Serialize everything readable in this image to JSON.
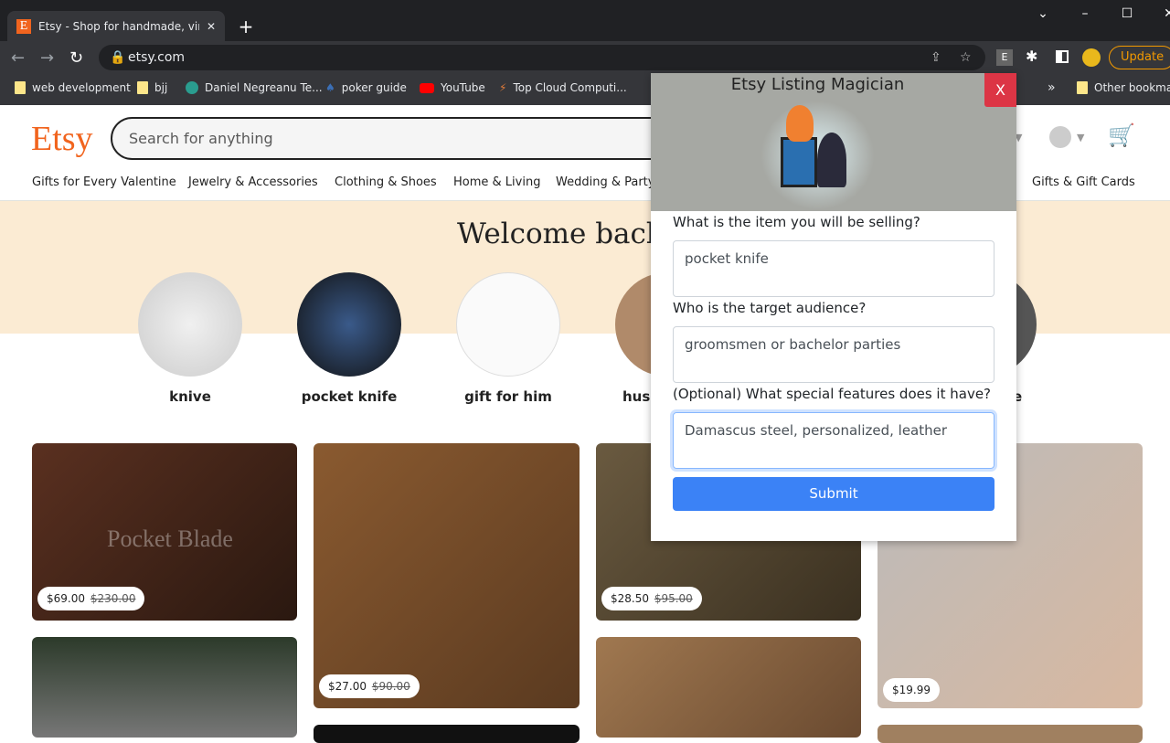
{
  "browser": {
    "tab_title": "Etsy - Shop for handmade, vintage",
    "url": "etsy.com",
    "update_label": "Update",
    "bookmarks": [
      "web development",
      "bjj",
      "Daniel Negreanu Te...",
      "poker guide",
      "YouTube",
      "Top Cloud Computi..."
    ],
    "other_bookmarks": "Other bookmarks"
  },
  "etsy": {
    "logo": "Etsy",
    "search_placeholder": "Search for anything",
    "categories": [
      "Gifts for Every Valentine",
      "Jewelry & Accessories",
      "Clothing & Shoes",
      "Home & Living",
      "Wedding & Party",
      "Gifts & Gift Cards"
    ],
    "welcome": "Welcome back,",
    "circles": [
      "knive",
      "pocket knife",
      "gift for him",
      "husb",
      "e"
    ],
    "listings": [
      {
        "price": "$69.00",
        "original": "$230.00"
      },
      {
        "price": "$27.00",
        "original": "$90.00"
      },
      {
        "price": "$28.50",
        "original": "$95.00"
      },
      {
        "price": "$19.99"
      }
    ],
    "image_watermark": "Pocket Blade"
  },
  "popup": {
    "title": "Etsy Listing Magician",
    "close_label": "X",
    "q1": "What is the item you will be selling?",
    "a1": "pocket knife",
    "q2": "Who is the target audience?",
    "a2": "groomsmen or bachelor parties",
    "q3": "(Optional) What special features does it have?",
    "a3": "Damascus steel, personalized, leather",
    "submit": "Submit"
  },
  "colors": {
    "etsy_orange": "#f1641e",
    "close_red": "#dc3545",
    "submit_blue": "#3b82f6"
  }
}
